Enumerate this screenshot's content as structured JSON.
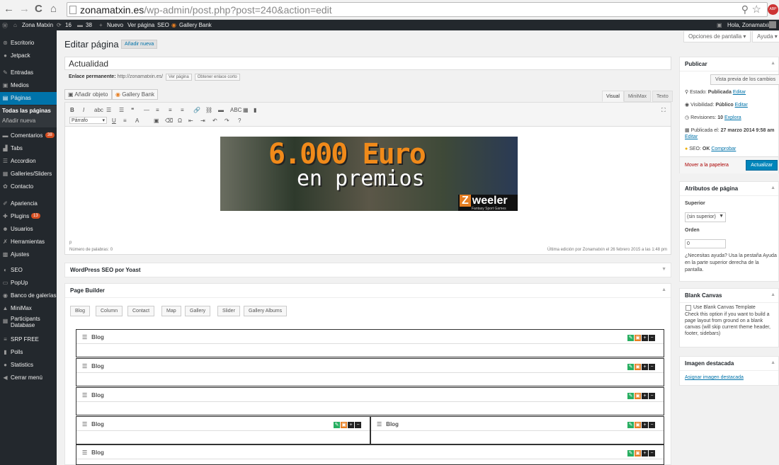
{
  "browser": {
    "url_domain": "zonamatxin.es",
    "url_path": "/wp-admin/post.php?post=240&action=edit",
    "back": "←",
    "forward": "→",
    "reload": "C",
    "home": "⌂",
    "star": "☆",
    "ext": "ABP",
    "zoom": "⚲"
  },
  "adminbar": {
    "site": "Zona Matxin",
    "updates": "16",
    "comments": "38",
    "new": "Nuevo",
    "view_page": "Ver página",
    "seo": "SEO",
    "gallery_bank": "Gallery Bank",
    "greeting": "Hola, Zonamatxin"
  },
  "sidebar": {
    "items": [
      {
        "label": "Escritorio",
        "icon": "dashboard-icon",
        "glyph": "⊛"
      },
      {
        "label": "Jetpack",
        "icon": "jetpack-icon",
        "glyph": "●"
      },
      {
        "label": "Entradas",
        "icon": "pin-icon",
        "glyph": "✎"
      },
      {
        "label": "Medios",
        "icon": "media-icon",
        "glyph": "▣"
      },
      {
        "label": "Páginas",
        "icon": "pages-icon",
        "glyph": "▤"
      },
      {
        "label": "Comentarios",
        "icon": "comments-icon",
        "glyph": "▬",
        "badge": "38"
      },
      {
        "label": "Tabs",
        "icon": "tabs-icon",
        "glyph": "▟"
      },
      {
        "label": "Accordion",
        "icon": "accordion-icon",
        "glyph": "☰"
      },
      {
        "label": "Galleries/Sliders",
        "icon": "gallery-icon",
        "glyph": "▦"
      },
      {
        "label": "Contacto",
        "icon": "contact-icon",
        "glyph": "✿"
      },
      {
        "label": "Apariencia",
        "icon": "appearance-icon",
        "glyph": "✐"
      },
      {
        "label": "Plugins",
        "icon": "plugins-icon",
        "glyph": "✚",
        "badge": "13"
      },
      {
        "label": "Usuarios",
        "icon": "users-icon",
        "glyph": "☻"
      },
      {
        "label": "Herramientas",
        "icon": "tools-icon",
        "glyph": "✗"
      },
      {
        "label": "Ajustes",
        "icon": "settings-icon",
        "glyph": "▩"
      },
      {
        "label": "SEO",
        "icon": "seo-icon",
        "glyph": "◐"
      },
      {
        "label": "PopUp",
        "icon": "popup-icon",
        "glyph": "▭"
      },
      {
        "label": "Banco de galerías",
        "icon": "gallery-bank-icon",
        "glyph": "◉"
      },
      {
        "label": "MiniMax",
        "icon": "minimax-icon",
        "glyph": "▲"
      },
      {
        "label": "Participants",
        "label2": "Database",
        "icon": "participants-icon",
        "glyph": "▦"
      },
      {
        "label": "SRP FREE",
        "icon": "srp-icon",
        "glyph": "≡"
      },
      {
        "label": "Polls",
        "icon": "polls-icon",
        "glyph": "▮"
      },
      {
        "label": "Statistics",
        "icon": "statistics-icon",
        "glyph": "●"
      },
      {
        "label": "Cerrar menú",
        "icon": "collapse-icon",
        "glyph": "◀"
      }
    ],
    "sub_all": "Todas las páginas",
    "sub_new": "Añadir nueva"
  },
  "screen_options": "Opciones de pantalla ▾",
  "help": "Ayuda ▾",
  "header": {
    "title": "Editar página",
    "add_new": "Añadir nueva"
  },
  "post": {
    "title": "Actualidad",
    "permalink_label": "Enlace permanente:",
    "permalink_url": "http://zonamatxin.es/",
    "view_page_btn": "Ver página",
    "shortlink_btn": "Obtener enlace corto"
  },
  "media": {
    "add_media": "Añadir objeto",
    "gallery_bank": "Gallery Bank"
  },
  "editor_tabs": [
    "Visual",
    "MiniMax",
    "Texto"
  ],
  "toolbar": {
    "row1": [
      "B",
      "I",
      "abc",
      "☰",
      "☰",
      "❝",
      "—",
      "≡",
      "≡",
      "≡",
      "🔗",
      "⛓",
      "▬",
      "ABC",
      "▦",
      "▮"
    ],
    "row2": [
      "U",
      "≡",
      "A",
      "▣",
      "⌫",
      "Ω",
      "⇤",
      "⇥",
      "↶",
      "↷",
      "?"
    ],
    "format": "Párrafo",
    "fullscreen": "⛶"
  },
  "banner": {
    "line1": "6.000 Euro",
    "line2": "en premios",
    "logo_z": "Z",
    "logo_text": "weeler",
    "tagline": "Fantasy Sport Games"
  },
  "editor_status": {
    "path": "p",
    "word_count": "Número de palabras: 0",
    "last_edit": "Última edición por Zonamatxin el 26 febrero 2015 a las 1:48 pm"
  },
  "seo_box": {
    "title": "WordPress SEO por Yoast"
  },
  "page_builder": {
    "title": "Page Builder",
    "buttons": [
      "Blog",
      "Column",
      "Contact",
      "Map",
      "Gallery",
      "Slider",
      "Gallery Albums"
    ],
    "row_label": "Blog"
  },
  "publish": {
    "title": "Publicar",
    "preview": "Vista previa de los cambios",
    "status_label": "Estado:",
    "status_value": "Publicada",
    "edit": "Editar",
    "visibility_label": "Visibilidad:",
    "visibility_value": "Público",
    "revisions_label": "Revisiones:",
    "revisions_value": "10",
    "explore": "Explora",
    "published_label": "Publicada el:",
    "published_value": "27 marzo 2014 9:58 am",
    "seo_label": "SEO:",
    "seo_value": "OK",
    "check": "Comprobar",
    "trash": "Mover a la papelera",
    "update": "Actualizar"
  },
  "attributes": {
    "title": "Atributos de página",
    "parent_label": "Superior",
    "parent_value": "(sin superior)",
    "order_label": "Orden",
    "order_value": "0",
    "help1": "¿Necesitas ayuda? Usa la pestaña Ayuda",
    "help2": "en la parte superior derecha de la",
    "help3": "pantalla."
  },
  "blank_canvas": {
    "title": "Blank Canvas",
    "checkbox": "Use Blank Canvas Template",
    "desc1": "Check this option if you want to build a",
    "desc2": "page layout from ground on a blank",
    "desc3": "canvas (will skip current theme header,",
    "desc4": "footer, sidebars)"
  },
  "featured": {
    "title": "Imagen destacada",
    "link": "Asignar imagen destacada"
  }
}
